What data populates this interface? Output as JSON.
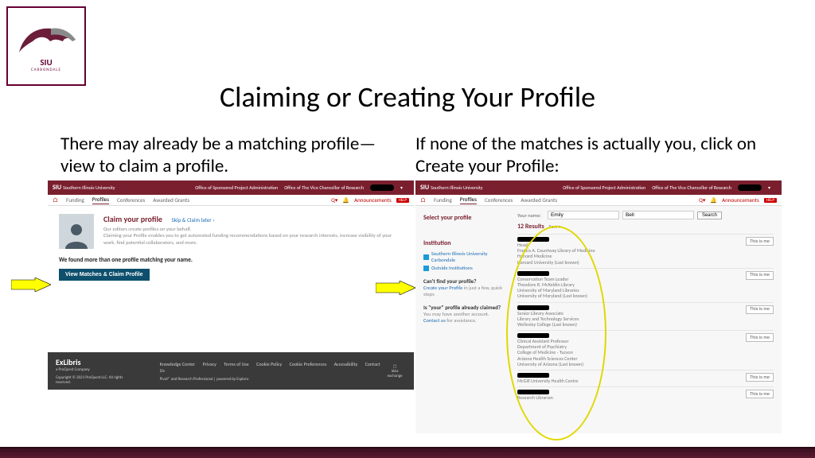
{
  "logo": {
    "big": "SIU",
    "sub": "CARBONDALE"
  },
  "title": "Claiming or Creating Your Profile",
  "left_caption": "There may already be a matching profile—view to claim a profile.",
  "right_caption": "If none of the matches is actually you, click on Create your Profile:",
  "app": {
    "brand": "SIU",
    "brand_sub": "Southern Illinois University",
    "top_links": [
      "Office of Sponsored Project Administration",
      "Office of The Vice Chancellor of Research"
    ],
    "nav": {
      "home": "⌂",
      "items": [
        "Funding",
        "Profiles",
        "Conferences",
        "Awarded Grants"
      ],
      "active": 1,
      "announcements": "Announcements",
      "help": "HELP"
    }
  },
  "claim": {
    "title": "Claim your profile",
    "skip": "Skip & Claim later ›",
    "line1": "Our editors create profiles on your behalf.",
    "line2": "Claiming your Profile enables you to get automated funding recommendations based on your research interests, increase visibility of your work, find potential collaborators, and more.",
    "found": "We found more than one profile matching your name.",
    "button": "View Matches & Claim Profile"
  },
  "footer": {
    "brand": "ExLibris",
    "brand_sub": "a ProQuest Company",
    "links": [
      "Knowledge Center",
      "Privacy",
      "Terms of Use",
      "Cookie Policy",
      "Cookie Preferences",
      "Accessibility",
      "Contact Us"
    ],
    "copy": "Copyright © 2021 ProQuest LLC. All rights reserved.",
    "powered": "Pivot® and Research Professional | powered by Esploro",
    "exchange": "idea exchange"
  },
  "select": {
    "heading": "Select your profile",
    "your_name": "Your name:",
    "first": "Emily",
    "last": "Bell",
    "search": "Search",
    "institution_h": "Institution",
    "institutions": [
      "Southern Illinois University Carbondale",
      "Outside Institutions"
    ],
    "cant_find_h": "Can't find your profile?",
    "create": "Create your Profile",
    "create_tail": " in just a few, quick steps",
    "claimed_h": "Is \"your\" profile already claimed?",
    "claimed_text": "You may have another account.",
    "contact": "Contact us",
    "contact_tail": " for assistance.",
    "results_h": "12 Results",
    "sort": "Sort ▾",
    "this_is_me": "This is me",
    "results": [
      {
        "lines": [
          "Head",
          "Francis A. Countway Library of Medicine",
          "Harvard Medicine",
          "Harvard University (Last known)"
        ]
      },
      {
        "lines": [
          "Conservation Team Leader",
          "Theodore R. McKeldin Library",
          "University of Maryland Libraries",
          "University of Maryland (Last known)"
        ]
      },
      {
        "lines": [
          "Senior Library Associate",
          "Library and Technology Services",
          "Wellesley College (Last known)"
        ]
      },
      {
        "lines": [
          "Clinical Assistant Professor",
          "Department of Psychiatry",
          "College of Medicine - Tucson",
          "Arizona Health Sciences Center",
          "University of Arizona (Last known)"
        ]
      },
      {
        "lines": [
          "McGill University Health Centre"
        ]
      },
      {
        "lines": [
          "Research Librarian"
        ]
      }
    ]
  }
}
